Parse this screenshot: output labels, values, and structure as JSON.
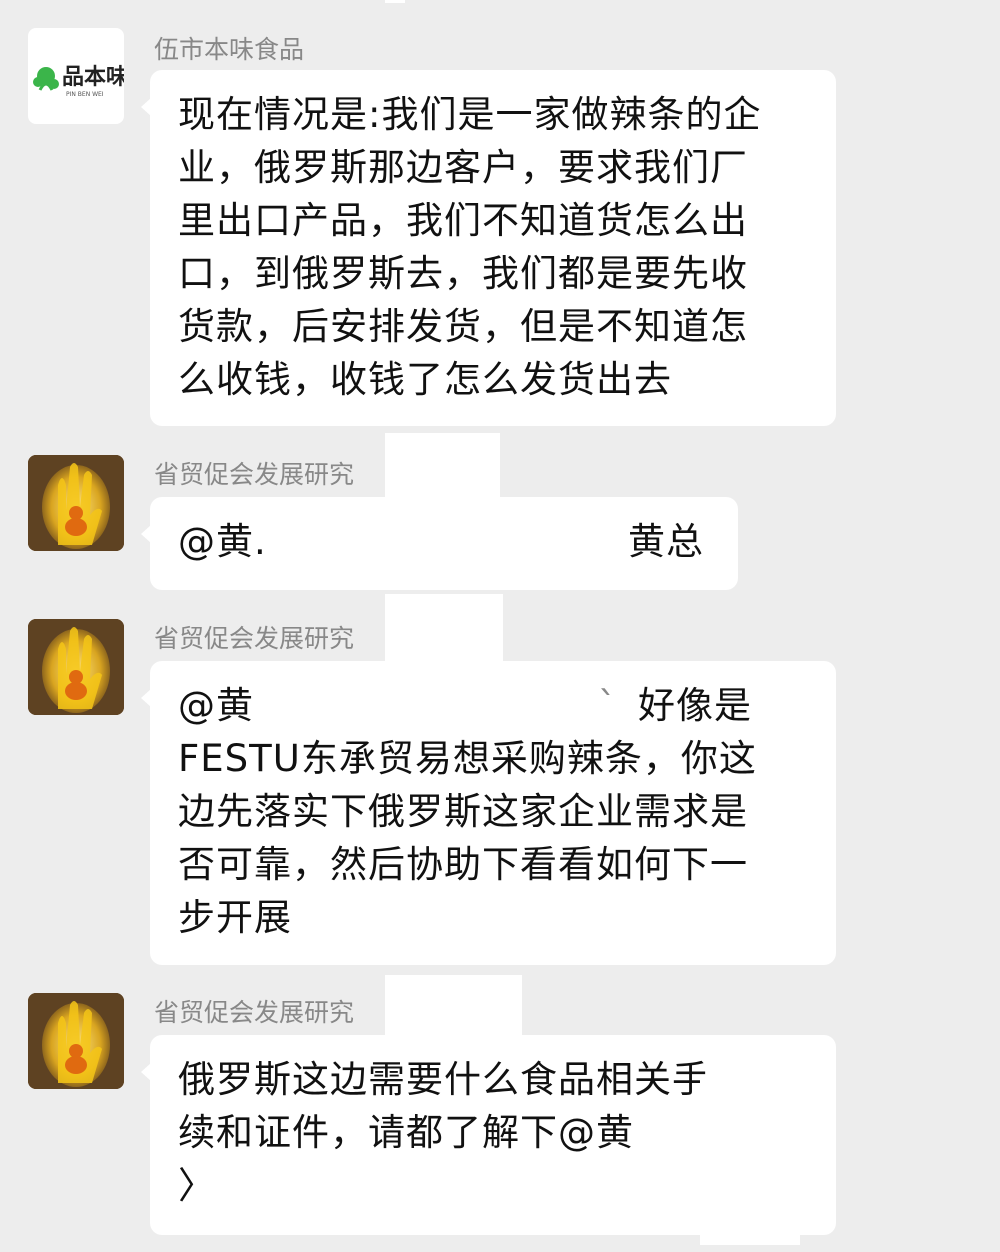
{
  "messages": [
    {
      "sender": "伍市本味食品",
      "avatar": {
        "icon": "pinbenwei-logo",
        "logo_text": "品本味",
        "logo_subtext": "PIN BEN WEI",
        "brand_color": "#3bb54a"
      },
      "lines": [
        "现在情况是:我们是一家做辣条的企",
        "业，俄罗斯那边客户，要求我们厂",
        "里出口产品，我们不知道货怎么出",
        "口，到俄罗斯去，我们都是要先收",
        "货款，后安排发货，但是不知道怎",
        "么收钱，收钱了怎么发货出去"
      ]
    },
    {
      "sender": "省贸促会发展研究",
      "avatar": {
        "icon": "golden-hand-buddha-avatar"
      },
      "mention_prefix": "@黄.",
      "mention_suffix": "黄总"
    },
    {
      "sender": "省贸促会发展研究",
      "avatar": {
        "icon": "golden-hand-buddha-avatar"
      },
      "first_line_prefix": "@黄",
      "first_line_mark": "ˋ",
      "first_line_suffix": "好像是",
      "lines": [
        "FESTU东承贸易想采购辣条，你这",
        "边先落实下俄罗斯这家企业需求是",
        "否可靠，然后协助下看看如何下一",
        "步开展"
      ]
    },
    {
      "sender": "省贸促会发展研究",
      "avatar": {
        "icon": "golden-hand-buddha-avatar"
      },
      "lines": [
        "俄罗斯这边需要什么食品相关手",
        "续和证件，请都了解下@黄",
        "〉"
      ]
    }
  ],
  "colors": {
    "chat_background": "#ededed",
    "bubble": "#ffffff",
    "sender_name": "#888888",
    "message_text": "#111111"
  }
}
